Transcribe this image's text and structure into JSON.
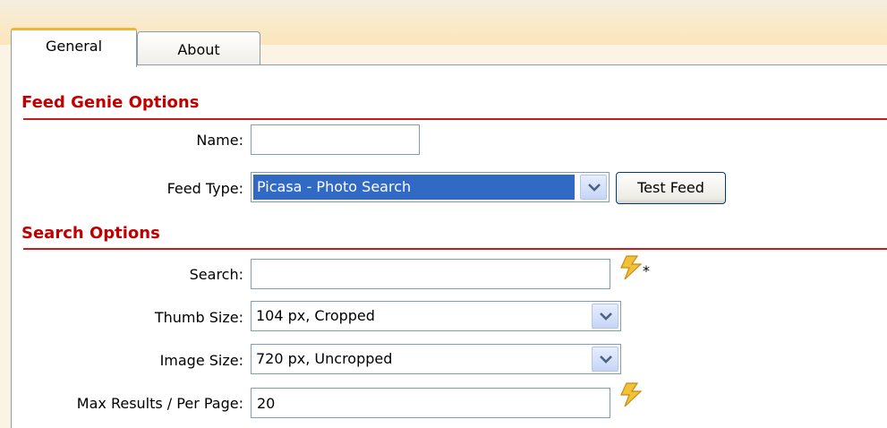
{
  "tabs": [
    {
      "label": "General",
      "active": true
    },
    {
      "label": "About",
      "active": false
    }
  ],
  "sections": {
    "feed_genie": {
      "title": "Feed Genie Options",
      "name_label": "Name:",
      "name_value": "",
      "feed_type_label": "Feed Type:",
      "feed_type_value": "Picasa - Photo Search",
      "test_feed_button": "Test Feed"
    },
    "search": {
      "title": "Search Options",
      "search_label": "Search:",
      "search_value": "",
      "required_marker": "*",
      "thumb_size_label": "Thumb Size:",
      "thumb_size_value": "104 px, Cropped",
      "image_size_label": "Image Size:",
      "image_size_value": "720 px, Uncropped",
      "max_results_label": "Max Results / Per Page:",
      "max_results_value": "20"
    }
  },
  "icons": {
    "dynamic_icon": "lightning-bolt-icon",
    "dropdown_icon": "chevron-down-icon"
  },
  "colors": {
    "section_title": "#c00000",
    "selection_highlight": "#316ac5",
    "active_tab_accent": "#f0b53b"
  }
}
